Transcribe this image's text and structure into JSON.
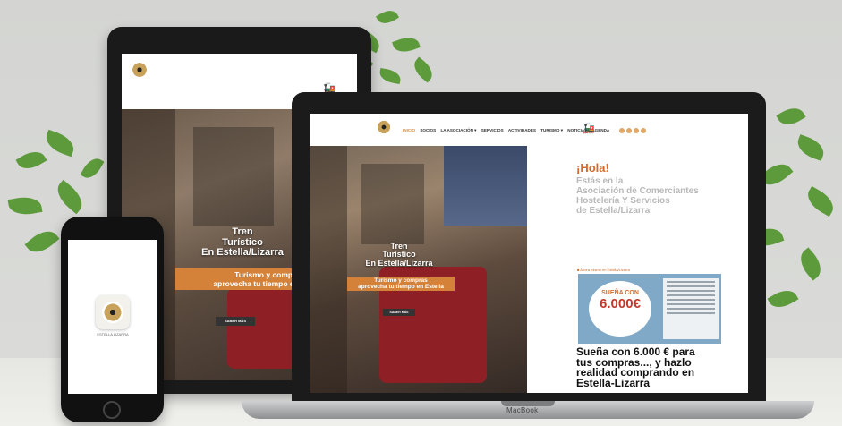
{
  "laptop": {
    "brand": "MacBook",
    "nav": [
      "INICIO",
      "SOCIOS",
      "LA ASOCIACIÓN ▾",
      "SERVICIOS",
      "ACTIVIDADES",
      "TURISMO ▾",
      "NOTICIAS",
      "AGENDA"
    ],
    "hero": {
      "title_lines": [
        "Tren",
        "Turístico",
        "En Estella/Lizarra"
      ],
      "subtitle_lines": [
        "Turismo y compras",
        "aprovecha tu tiempo en Estella"
      ],
      "button": "SABER MÁS"
    },
    "greeting": "¡Hola!",
    "intro_lines": [
      "Estás en la",
      "Asociación de Comerciantes",
      "Hostelería Y Servicios",
      "de Estella/Lizarra"
    ],
    "promo": {
      "head": "■ Ahora mismo en Estella/Lizarra",
      "bubble_lines": [
        "SUEÑA CON",
        "6.000€"
      ]
    },
    "headline_lines": [
      "Sueña con 6.000 € para",
      "tus compras..., y hazlo",
      "realidad comprando en",
      "Estella-Lizarra"
    ]
  },
  "tablet": {
    "hero": {
      "title_lines": [
        "Tren",
        "Turístico",
        "En Estella/Lizarra"
      ],
      "subtitle_lines": [
        "Turismo y compras",
        "aprovecha tu tiempo en Estella"
      ],
      "button": "SABER MÁS"
    }
  },
  "phone": {
    "app_label": "ESTELLA LIZARRA"
  },
  "colors": {
    "accent": "#d46b2c",
    "gold": "#c8a15a"
  }
}
